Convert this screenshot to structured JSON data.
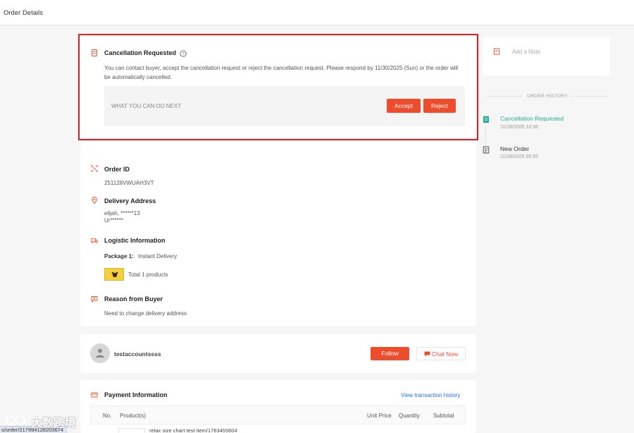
{
  "header": {
    "title": "Order Details"
  },
  "cancellation": {
    "title": "Cancellation Requested",
    "message": "You can contact buyer, accept the cancellation request or reject the cancellation request. Please respond by 11/30/2025 (Sun) or the order will be automatically cancelled.",
    "next_label": "WHAT YOU CAN DO NEXT",
    "accept_label": "Accept",
    "reject_label": "Reject"
  },
  "order": {
    "id_title": "Order ID",
    "id_value": "251128VWUAH3VT",
    "address_title": "Delivery Address",
    "address_line1": "elijah, ******13",
    "address_line2": "Ur******",
    "logistic_title": "Logistic Information",
    "package_label": "Package 1:",
    "package_value": "Instant Delivery",
    "products_total": "Total 1 products",
    "reason_title": "Reason from Buyer",
    "reason_value": "Need to change delivery address"
  },
  "buyer": {
    "username": "testaccountssss",
    "follow_label": "Follow",
    "chat_label": "Chat Now"
  },
  "payment": {
    "title": "Payment Information",
    "history_link": "View transaction history",
    "columns": [
      "No.",
      "Product(s)",
      "Unit Price",
      "Quantity",
      "Subtotal"
    ],
    "first_product": "relax size chart test item/1763455604"
  },
  "sidebar": {
    "note_placeholder": "Add a Note",
    "history_title": "ORDER HISTORY",
    "history": [
      {
        "label": "Cancellation Requested",
        "time": "11/28/2025 10:36"
      },
      {
        "label": "New Order",
        "time": "11/28/2025 09:55"
      }
    ]
  },
  "overlay": {
    "status_url": "s/order/217994128203674",
    "watermark": "大数跨境"
  },
  "colors": {
    "accent": "#ee4d2d",
    "highlight_box": "#e02020",
    "history_active": "#26aa99",
    "link": "#2673dd"
  }
}
